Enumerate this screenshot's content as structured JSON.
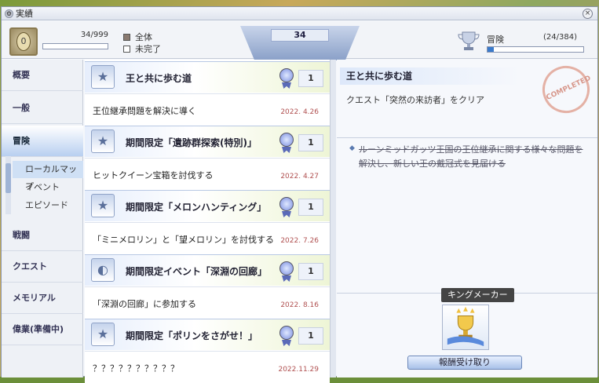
{
  "window": {
    "title": "実績"
  },
  "header": {
    "level": "0",
    "points": "34/999",
    "legend_all": "全体",
    "legend_incomplete": "未完了",
    "total": "34",
    "category": "冒険",
    "category_count": "(24/384)",
    "category_progress": 0.0625
  },
  "sidebar": {
    "items": [
      "概要",
      "一般",
      "冒険",
      "戦闘",
      "クエスト",
      "メモリアル",
      "偉業(準備中)"
    ],
    "subitems": [
      "ローカルマップ",
      "イベント",
      "エピソード"
    ]
  },
  "achievements": [
    {
      "title": "王と共に歩む道",
      "points": "1",
      "desc": "王位継承問題を解決に導く",
      "date": "2022. 4.26"
    },
    {
      "title": "期間限定「遺跡群探索(特別)」",
      "points": "1",
      "desc": "ヒットクイーン宝箱を討伐する",
      "date": "2022. 4.27"
    },
    {
      "title": "期間限定「メロンハンティング」",
      "points": "1",
      "desc": "「ミニメロリン」と「望メロリン」を討伐する",
      "date": "2022. 7.26"
    },
    {
      "title": "期間限定イベント「深淵の回廊」",
      "points": "1",
      "desc": "「深淵の回廊」に参加する",
      "date": "2022. 8.16"
    },
    {
      "title": "期間限定「ポリンをさがせ！」",
      "points": "1",
      "desc": "？？？？？？？？？？",
      "date": "2022.11.29"
    }
  ],
  "detail": {
    "title": "王と共に歩む道",
    "subtitle": "クエスト「突然の来訪者」をクリア",
    "stamp": "COMPLETED",
    "body": "ルーンミッドガッツ王国の王位継承に関する様々な問題を解決し、新しい王の戴冠式を見届ける",
    "reward_name": "キングメーカー",
    "claim_button": "報酬受け取り"
  }
}
